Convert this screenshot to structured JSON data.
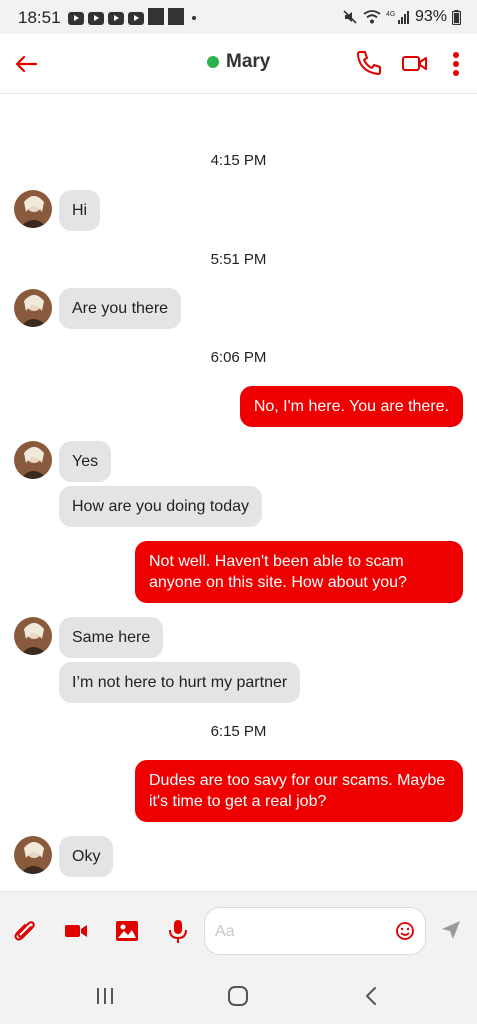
{
  "status_bar": {
    "time": "18:51",
    "battery": "93%"
  },
  "header": {
    "contact_name": "Mary",
    "online": true,
    "colors": {
      "accent": "#ee0000",
      "online": "#2bb24c"
    }
  },
  "conversation": {
    "timestamps": [
      "4:15 PM",
      "5:51 PM",
      "6:06 PM",
      "6:15 PM"
    ],
    "messages": [
      {
        "from": "contact",
        "text": "Hi"
      },
      {
        "from": "contact",
        "text": "Are you there"
      },
      {
        "from": "me",
        "text": "No, I'm here. You are there."
      },
      {
        "from": "contact",
        "text": "Yes"
      },
      {
        "from": "contact",
        "text": "How are you doing today"
      },
      {
        "from": "me",
        "text": "Not well. Haven't been able to scam anyone on this site. How about you?"
      },
      {
        "from": "contact",
        "text": "Same here"
      },
      {
        "from": "contact",
        "text": "I’m not here to hurt my partner"
      },
      {
        "from": "me",
        "text": "Dudes are too savy for our scams. Maybe it's time to get a real job?"
      },
      {
        "from": "contact",
        "text": "Oky"
      }
    ]
  },
  "composer": {
    "placeholder": "Aa",
    "icons": [
      "paperclip-icon",
      "video-icon",
      "image-icon",
      "microphone-icon",
      "emoji-icon",
      "send-icon"
    ]
  },
  "nav": {
    "icons": [
      "recent-apps-icon",
      "home-icon",
      "back-nav-icon"
    ]
  }
}
